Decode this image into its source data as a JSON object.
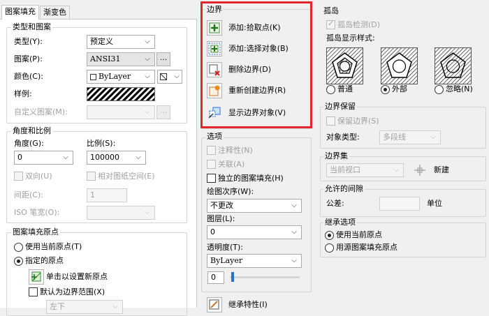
{
  "tabs": {
    "hatch": "图案填充",
    "gradient": "渐变色"
  },
  "type_pattern": {
    "title": "类型和图案",
    "type_label": "类型(Y):",
    "type_value": "预定义",
    "pattern_label": "图案(P):",
    "pattern_value": "ANSI31",
    "color_label": "颜色(C):",
    "color_value": "ByLayer",
    "swatch_label": "样例:",
    "custom_label": "自定义图案(M):",
    "dots": "..."
  },
  "angle_scale": {
    "title": "角度和比例",
    "angle_label": "角度(G):",
    "angle_value": "0",
    "scale_label": "比例(S):",
    "scale_value": "100000",
    "double_label": "双向(U)",
    "relative_label": "相对图纸空间(E)",
    "spacing_label": "间距(C):",
    "spacing_value": "1",
    "iso_label": "ISO 笔宽(O):"
  },
  "origin": {
    "title": "图案填充原点",
    "use_current": "使用当前原点(T)",
    "specified": "指定的原点",
    "click_set": "单击以设置新原点",
    "default_extent": "默认为边界范围(X)",
    "position_value": "左下"
  },
  "boundaries": {
    "title": "边界",
    "add_pick": "添加:拾取点(K)",
    "add_select": "添加:选择对象(B)",
    "remove": "删除边界(D)",
    "recreate": "重新创建边界(R)",
    "view": "显示边界对象(V)"
  },
  "options": {
    "title": "选项",
    "annotative": "注释性(N)",
    "associative": "关联(A)",
    "separate": "独立的图案填充(H)",
    "draw_order_label": "绘图次序(W):",
    "draw_order_value": "不更改",
    "layer_label": "图层(L):",
    "layer_value": "0",
    "transparency_label": "透明度(T):",
    "transparency_value": "ByLayer",
    "transparency_amount": "0",
    "inherit": "继承特性(I)"
  },
  "islands": {
    "title": "孤岛",
    "detection": "孤岛检测(D)",
    "style_label": "孤岛显示样式:",
    "normal": "普通",
    "outer": "外部",
    "ignore": "忽略(N)"
  },
  "retention": {
    "title": "边界保留",
    "retain": "保留边界(S)",
    "object_type_label": "对象类型:",
    "object_type_value": "多段线"
  },
  "boundary_set": {
    "title": "边界集",
    "value": "当前视口",
    "new_label": "新建"
  },
  "gap": {
    "title": "允许的间隙",
    "tolerance_label": "公差:",
    "unit": "单位"
  },
  "inherit_options": {
    "title": "继承选项",
    "use_current": "使用当前原点",
    "use_source": "用源图案填充原点"
  },
  "colors": {
    "highlight": "#e3262d",
    "panel": "#f0f0f0",
    "border": "#d5d5d5"
  }
}
